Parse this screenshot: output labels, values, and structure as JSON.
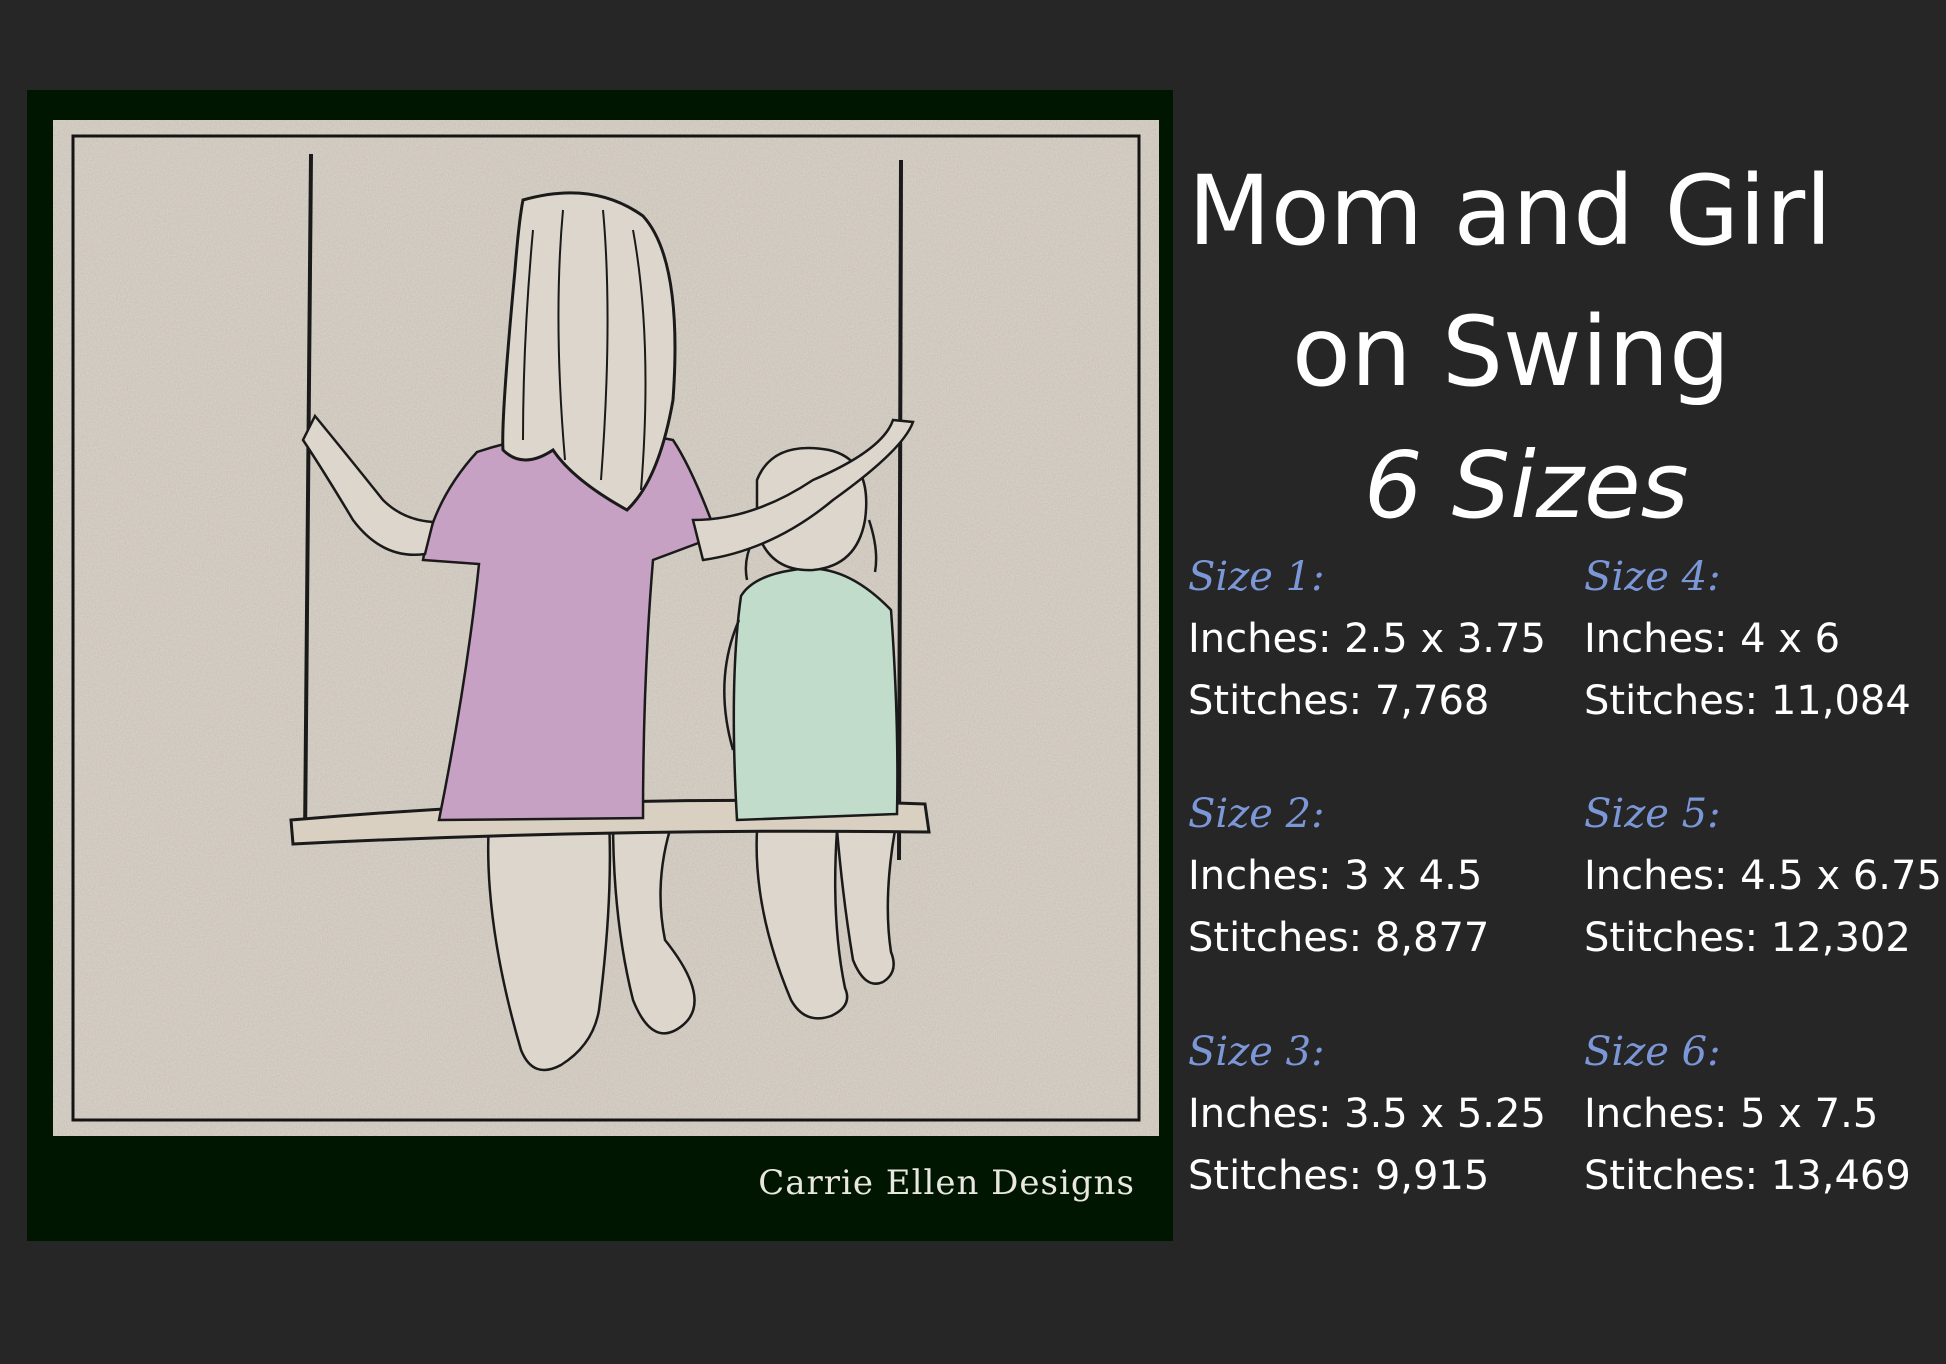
{
  "title": {
    "line1": "Mom and Girl",
    "line2": "on Swing",
    "line3": "6 Sizes"
  },
  "brand": "Carrie Ellen Designs",
  "sizes": [
    {
      "label": "Size 1:",
      "inches": "Inches: 2.5 x 3.75",
      "stitches": "Stitches: 7,768"
    },
    {
      "label": "Size 2:",
      "inches": "Inches: 3 x 4.5",
      "stitches": "Stitches: 8,877"
    },
    {
      "label": "Size 3:",
      "inches": "Inches: 3.5 x 5.25",
      "stitches": "Stitches: 9,915"
    },
    {
      "label": "Size 4:",
      "inches": "Inches: 4 x 6",
      "stitches": "Stitches: 11,084"
    },
    {
      "label": "Size 5:",
      "inches": "Inches: 4.5 x 6.75",
      "stitches": "Stitches: 12,302"
    },
    {
      "label": "Size 6:",
      "inches": "Inches: 5 x 7.5",
      "stitches": "Stitches: 13,469"
    }
  ],
  "colors": {
    "background": "#262626",
    "panel": "#011601",
    "linen": "#ddd6cc",
    "mom_dress": "#c7a1c3",
    "girl_top": "#c2dccb",
    "size_label": "#7c97d8"
  }
}
